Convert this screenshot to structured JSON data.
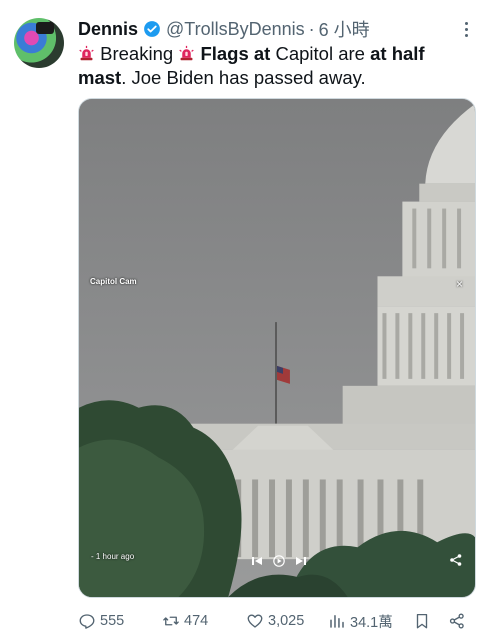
{
  "tweet": {
    "author_name": "Dennis",
    "handle": "@TrollsByDennis",
    "separator": "·",
    "time": "6 小時",
    "text": {
      "part1": " Breaking ",
      "part2_bold": "Flags at",
      "part3": " Capitol are ",
      "part4_bold": "at half mast",
      "part5": ". Joe Biden has passed away."
    }
  },
  "media": {
    "cam_label": "Capitol Cam",
    "close_symbol": "×",
    "time_ago": "- 1 hour ago"
  },
  "actions": {
    "replies": "555",
    "reposts": "474",
    "likes": "3,025",
    "views": "34.1萬"
  },
  "colors": {
    "verified": "#1d9bf0",
    "muted": "#536471",
    "siren": "#e0245e"
  }
}
